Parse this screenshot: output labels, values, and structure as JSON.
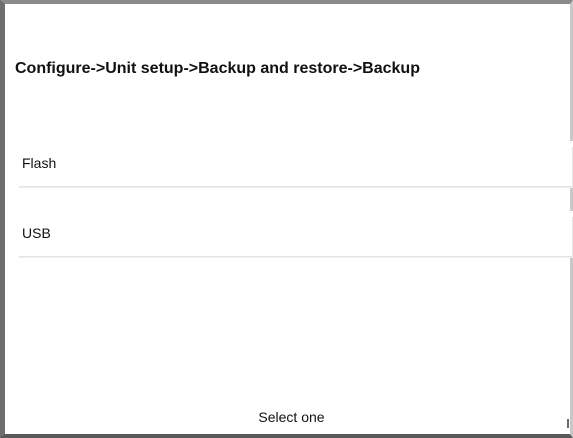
{
  "header": {
    "breadcrumb": "Configure->Unit setup->Backup and restore->Backup"
  },
  "options": [
    {
      "label": "Flash"
    },
    {
      "label": "USB"
    }
  ],
  "footer": {
    "status": "Select one"
  }
}
